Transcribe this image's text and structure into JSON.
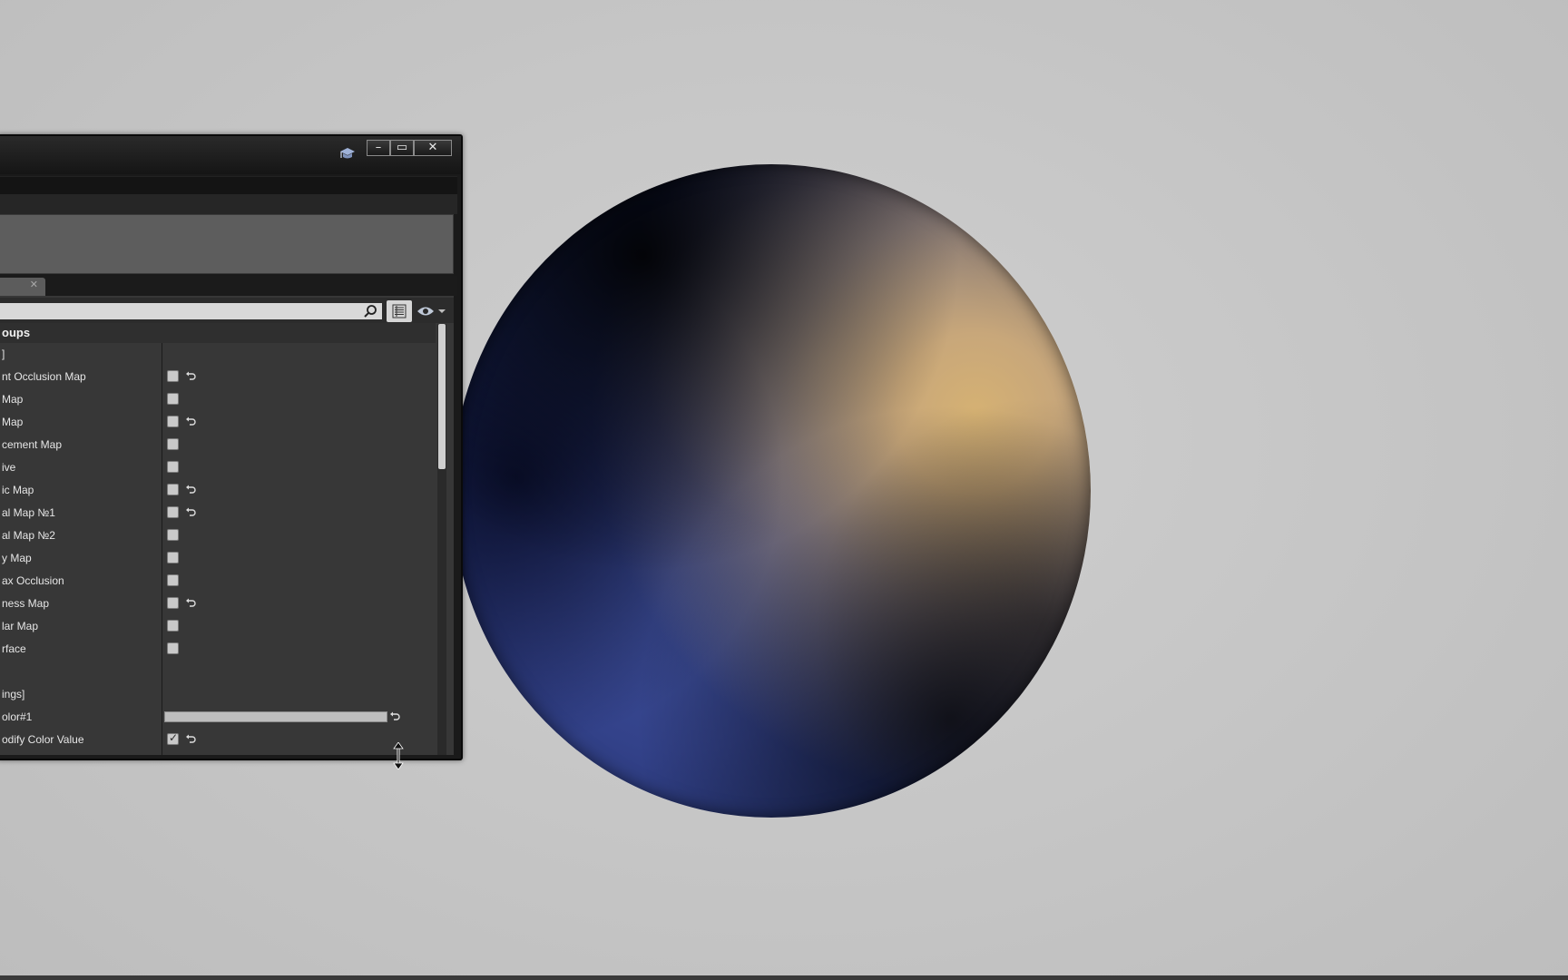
{
  "details_panel": {
    "search": {
      "placeholder": "",
      "value": ""
    },
    "group_header": "oups",
    "rows": [
      {
        "label": "]",
        "type": "section"
      },
      {
        "label": "nt Occlusion Map",
        "type": "checkbox",
        "checked": false,
        "reset": true
      },
      {
        "label": "Map",
        "type": "checkbox",
        "checked": false,
        "reset": false
      },
      {
        "label": "Map",
        "type": "checkbox",
        "checked": false,
        "reset": true
      },
      {
        "label": "cement Map",
        "type": "checkbox",
        "checked": false,
        "reset": false
      },
      {
        "label": "ive",
        "type": "checkbox",
        "checked": false,
        "reset": false
      },
      {
        "label": "ic Map",
        "type": "checkbox",
        "checked": false,
        "reset": true
      },
      {
        "label": "al Map №1",
        "type": "checkbox",
        "checked": false,
        "reset": true
      },
      {
        "label": "al Map №2",
        "type": "checkbox",
        "checked": false,
        "reset": false
      },
      {
        "label": "y Map",
        "type": "checkbox",
        "checked": false,
        "reset": false
      },
      {
        "label": "ax Occlusion",
        "type": "checkbox",
        "checked": false,
        "reset": false
      },
      {
        "label": "ness Map",
        "type": "checkbox",
        "checked": false,
        "reset": true
      },
      {
        "label": "lar Map",
        "type": "checkbox",
        "checked": false,
        "reset": false
      },
      {
        "label": "rface",
        "type": "checkbox",
        "checked": false,
        "reset": false
      },
      {
        "label": "",
        "type": "blank"
      },
      {
        "label": "ings]",
        "type": "section"
      },
      {
        "label": "olor#1",
        "type": "color",
        "reset": true
      },
      {
        "label": "odify Color Value",
        "type": "checkbox",
        "checked": true,
        "reset": true
      }
    ]
  },
  "icons": {
    "help": "graduation-cap-icon",
    "search": "magnifier-icon",
    "view_options": "eye-icon",
    "list_view": "list-view-icon",
    "reset": "reset-arrow-icon",
    "cursor": "vertical-resize-cursor-icon"
  },
  "colors": {
    "sphere_blue": "#3e4f99",
    "sphere_gold": "#d5b173",
    "background": "#c8c8c8",
    "panel_bg": "#373737"
  }
}
